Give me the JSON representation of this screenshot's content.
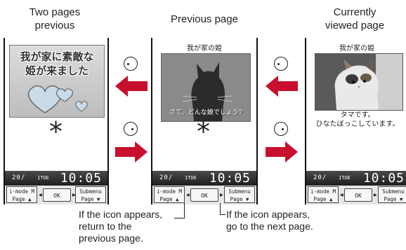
{
  "labels": {
    "two_pages_previous": [
      "Two pages",
      "previous"
    ],
    "previous_page": "Previous page",
    "currently_viewed": [
      "Currently",
      "viewed page"
    ]
  },
  "phone": {
    "date": "20/",
    "day": "1TUE",
    "time": "10:05",
    "softkey_left": [
      "i-mode M",
      "Page ▲"
    ],
    "softkey_ok": "OK",
    "softkey_right": [
      "Submenu",
      "Page ▼"
    ]
  },
  "screens": {
    "left": {
      "banner": [
        "我が家に素敵な",
        "姫が来ました"
      ],
      "asterisk": "*"
    },
    "middle": {
      "title": "我が家の姫",
      "caption": "さて、どんな娘でしょう?",
      "asterisk": "*"
    },
    "right": {
      "title": "我が家の姫",
      "caption": [
        "タマです。",
        "ひなたぼっこしています。"
      ]
    }
  },
  "callouts": {
    "return_previous": [
      "If the icon appears,",
      "return to the",
      "previous page."
    ],
    "go_next": [
      "If the icon appears,",
      "go to the next page."
    ]
  },
  "colors": {
    "arrow": "#c8102e",
    "frame": "#111111",
    "status_bar": "#2a2a2a",
    "heart_fill": "#c9dae8"
  }
}
